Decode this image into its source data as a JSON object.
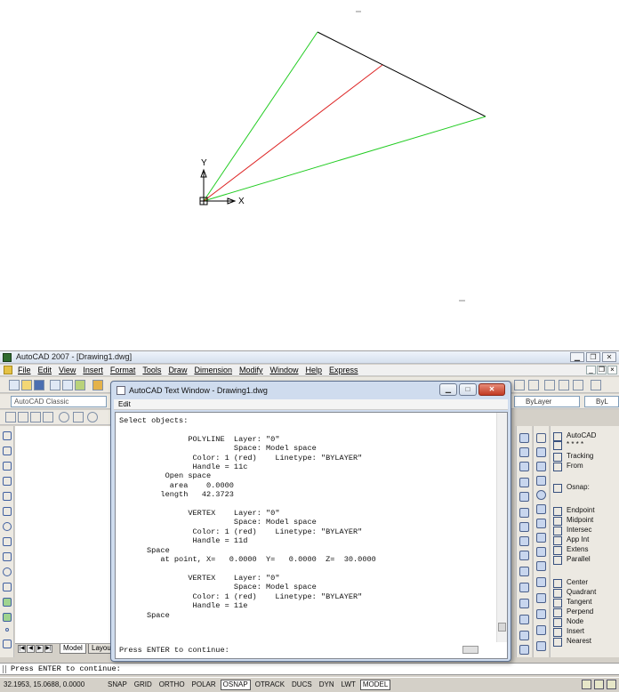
{
  "viewport": {
    "axis_x_label": "X",
    "axis_y_label": "Y"
  },
  "app": {
    "title": "AutoCAD 2007 - [Drawing1.dwg]",
    "menus": [
      "File",
      "Edit",
      "View",
      "Insert",
      "Format",
      "Tools",
      "Draw",
      "Dimension",
      "Modify",
      "Window",
      "Help",
      "Express"
    ],
    "workspace": "AutoCAD Classic",
    "layer_color": "ByLayer",
    "layer_linetype": "ByL"
  },
  "layout_tabs": {
    "model": "Model",
    "layout": "Layou"
  },
  "text_window": {
    "title": "AutoCAD Text Window - Drawing1.dwg",
    "menu_edit": "Edit",
    "content": "Select objects:\n\n               POLYLINE  Layer: \"0\"\n                         Space: Model space\n                Color: 1 (red)    Linetype: \"BYLAYER\"\n                Handle = 11c\n          Open space\n           area    0.0000\n         length   42.3723\n\n               VERTEX    Layer: \"0\"\n                         Space: Model space\n                Color: 1 (red)    Linetype: \"BYLAYER\"\n                Handle = 11d\n      Space\n         at point, X=   0.0000  Y=   0.0000  Z=  30.0000\n\n               VERTEX    Layer: \"0\"\n                         Space: Model space\n                Color: 1 (red)    Linetype: \"BYLAYER\"\n                Handle = 11e\n      Space",
    "prompt": "Press ENTER to continue:"
  },
  "osnap": {
    "items": [
      "AutoCAD",
      "* * * *",
      "Tracking",
      "From",
      "",
      "Osnap:",
      "",
      "Endpoint",
      "Midpoint",
      "Intersec",
      "App Int",
      "Extens",
      "Parallel",
      "",
      "Center",
      "Quadrant",
      "Tangent",
      "Perpend",
      "Node",
      "Insert",
      "Nearest"
    ]
  },
  "command_line": {
    "text": "Press ENTER to continue:"
  },
  "status": {
    "coords": "32.1953,  15.0688, 0.0000",
    "toggles": [
      {
        "label": "SNAP",
        "on": false
      },
      {
        "label": "GRID",
        "on": false
      },
      {
        "label": "ORTHO",
        "on": false
      },
      {
        "label": "POLAR",
        "on": false
      },
      {
        "label": "OSNAP",
        "on": true
      },
      {
        "label": "OTRACK",
        "on": false
      },
      {
        "label": "DUCS",
        "on": false
      },
      {
        "label": "DYN",
        "on": false
      },
      {
        "label": "LWT",
        "on": false
      },
      {
        "label": "MODEL",
        "on": true
      }
    ]
  },
  "colors": {
    "green_line": "#22cc22",
    "red_line": "#dd2222",
    "black_line": "#000000"
  }
}
